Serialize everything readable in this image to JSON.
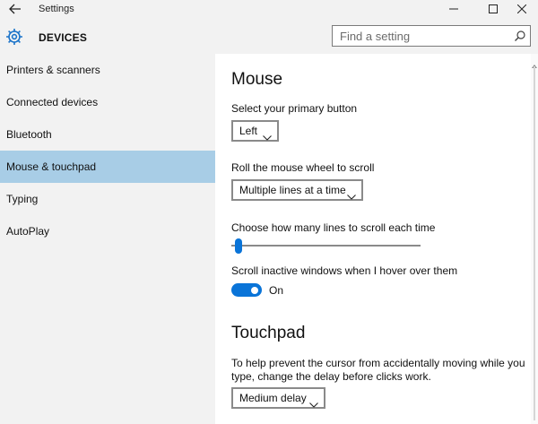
{
  "window": {
    "title": "Settings",
    "back_icon": "back-arrow-icon",
    "controls": [
      "minimize-icon",
      "maximize-icon",
      "close-icon"
    ]
  },
  "header": {
    "section": "DEVICES",
    "icon": "gear-icon",
    "search_placeholder": "Find a setting"
  },
  "sidebar": {
    "selected_color": "#a8cde6",
    "items": [
      {
        "label": "Printers & scanners"
      },
      {
        "label": "Connected devices"
      },
      {
        "label": "Bluetooth"
      },
      {
        "label": "Mouse & touchpad",
        "selected": true
      },
      {
        "label": "Typing"
      },
      {
        "label": "AutoPlay"
      }
    ]
  },
  "mouse": {
    "heading": "Mouse",
    "primary_button_label": "Select your primary button",
    "primary_button_value": "Left",
    "wheel_label": "Roll the mouse wheel to scroll",
    "wheel_value": "Multiple lines at a time",
    "lines_label": "Choose how many lines to scroll each time",
    "lines_slider_fraction": 0.02,
    "inactive_label": "Scroll inactive windows when I hover over them",
    "inactive_toggle_state": "On",
    "accent_color": "#0a74d8"
  },
  "touchpad": {
    "heading": "Touchpad",
    "description_line1": "To help prevent the cursor from accidentally moving while you",
    "description_line2": "type, change the delay before clicks work.",
    "delay_value": "Medium delay"
  }
}
